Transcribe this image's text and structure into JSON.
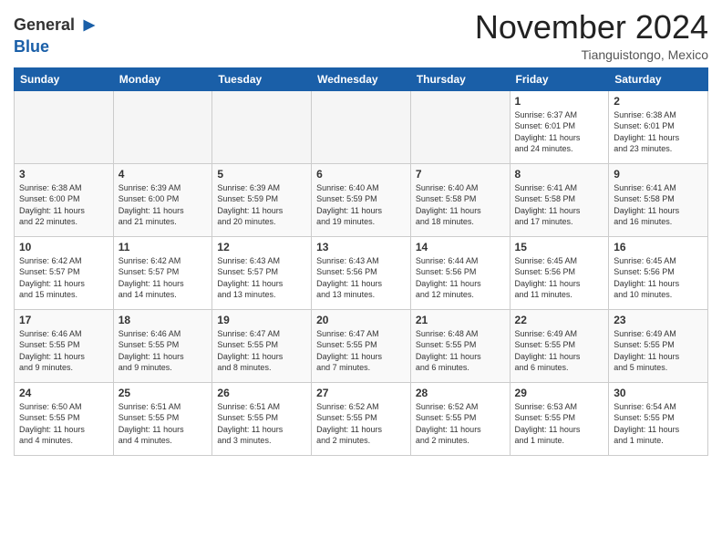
{
  "header": {
    "logo_line1": "General",
    "logo_line2": "Blue",
    "month": "November 2024",
    "location": "Tianguistongo, Mexico"
  },
  "weekdays": [
    "Sunday",
    "Monday",
    "Tuesday",
    "Wednesday",
    "Thursday",
    "Friday",
    "Saturday"
  ],
  "weeks": [
    [
      {
        "day": "",
        "info": ""
      },
      {
        "day": "",
        "info": ""
      },
      {
        "day": "",
        "info": ""
      },
      {
        "day": "",
        "info": ""
      },
      {
        "day": "",
        "info": ""
      },
      {
        "day": "1",
        "info": "Sunrise: 6:37 AM\nSunset: 6:01 PM\nDaylight: 11 hours\nand 24 minutes."
      },
      {
        "day": "2",
        "info": "Sunrise: 6:38 AM\nSunset: 6:01 PM\nDaylight: 11 hours\nand 23 minutes."
      }
    ],
    [
      {
        "day": "3",
        "info": "Sunrise: 6:38 AM\nSunset: 6:00 PM\nDaylight: 11 hours\nand 22 minutes."
      },
      {
        "day": "4",
        "info": "Sunrise: 6:39 AM\nSunset: 6:00 PM\nDaylight: 11 hours\nand 21 minutes."
      },
      {
        "day": "5",
        "info": "Sunrise: 6:39 AM\nSunset: 5:59 PM\nDaylight: 11 hours\nand 20 minutes."
      },
      {
        "day": "6",
        "info": "Sunrise: 6:40 AM\nSunset: 5:59 PM\nDaylight: 11 hours\nand 19 minutes."
      },
      {
        "day": "7",
        "info": "Sunrise: 6:40 AM\nSunset: 5:58 PM\nDaylight: 11 hours\nand 18 minutes."
      },
      {
        "day": "8",
        "info": "Sunrise: 6:41 AM\nSunset: 5:58 PM\nDaylight: 11 hours\nand 17 minutes."
      },
      {
        "day": "9",
        "info": "Sunrise: 6:41 AM\nSunset: 5:58 PM\nDaylight: 11 hours\nand 16 minutes."
      }
    ],
    [
      {
        "day": "10",
        "info": "Sunrise: 6:42 AM\nSunset: 5:57 PM\nDaylight: 11 hours\nand 15 minutes."
      },
      {
        "day": "11",
        "info": "Sunrise: 6:42 AM\nSunset: 5:57 PM\nDaylight: 11 hours\nand 14 minutes."
      },
      {
        "day": "12",
        "info": "Sunrise: 6:43 AM\nSunset: 5:57 PM\nDaylight: 11 hours\nand 13 minutes."
      },
      {
        "day": "13",
        "info": "Sunrise: 6:43 AM\nSunset: 5:56 PM\nDaylight: 11 hours\nand 13 minutes."
      },
      {
        "day": "14",
        "info": "Sunrise: 6:44 AM\nSunset: 5:56 PM\nDaylight: 11 hours\nand 12 minutes."
      },
      {
        "day": "15",
        "info": "Sunrise: 6:45 AM\nSunset: 5:56 PM\nDaylight: 11 hours\nand 11 minutes."
      },
      {
        "day": "16",
        "info": "Sunrise: 6:45 AM\nSunset: 5:56 PM\nDaylight: 11 hours\nand 10 minutes."
      }
    ],
    [
      {
        "day": "17",
        "info": "Sunrise: 6:46 AM\nSunset: 5:55 PM\nDaylight: 11 hours\nand 9 minutes."
      },
      {
        "day": "18",
        "info": "Sunrise: 6:46 AM\nSunset: 5:55 PM\nDaylight: 11 hours\nand 9 minutes."
      },
      {
        "day": "19",
        "info": "Sunrise: 6:47 AM\nSunset: 5:55 PM\nDaylight: 11 hours\nand 8 minutes."
      },
      {
        "day": "20",
        "info": "Sunrise: 6:47 AM\nSunset: 5:55 PM\nDaylight: 11 hours\nand 7 minutes."
      },
      {
        "day": "21",
        "info": "Sunrise: 6:48 AM\nSunset: 5:55 PM\nDaylight: 11 hours\nand 6 minutes."
      },
      {
        "day": "22",
        "info": "Sunrise: 6:49 AM\nSunset: 5:55 PM\nDaylight: 11 hours\nand 6 minutes."
      },
      {
        "day": "23",
        "info": "Sunrise: 6:49 AM\nSunset: 5:55 PM\nDaylight: 11 hours\nand 5 minutes."
      }
    ],
    [
      {
        "day": "24",
        "info": "Sunrise: 6:50 AM\nSunset: 5:55 PM\nDaylight: 11 hours\nand 4 minutes."
      },
      {
        "day": "25",
        "info": "Sunrise: 6:51 AM\nSunset: 5:55 PM\nDaylight: 11 hours\nand 4 minutes."
      },
      {
        "day": "26",
        "info": "Sunrise: 6:51 AM\nSunset: 5:55 PM\nDaylight: 11 hours\nand 3 minutes."
      },
      {
        "day": "27",
        "info": "Sunrise: 6:52 AM\nSunset: 5:55 PM\nDaylight: 11 hours\nand 2 minutes."
      },
      {
        "day": "28",
        "info": "Sunrise: 6:52 AM\nSunset: 5:55 PM\nDaylight: 11 hours\nand 2 minutes."
      },
      {
        "day": "29",
        "info": "Sunrise: 6:53 AM\nSunset: 5:55 PM\nDaylight: 11 hours\nand 1 minute."
      },
      {
        "day": "30",
        "info": "Sunrise: 6:54 AM\nSunset: 5:55 PM\nDaylight: 11 hours\nand 1 minute."
      }
    ]
  ]
}
